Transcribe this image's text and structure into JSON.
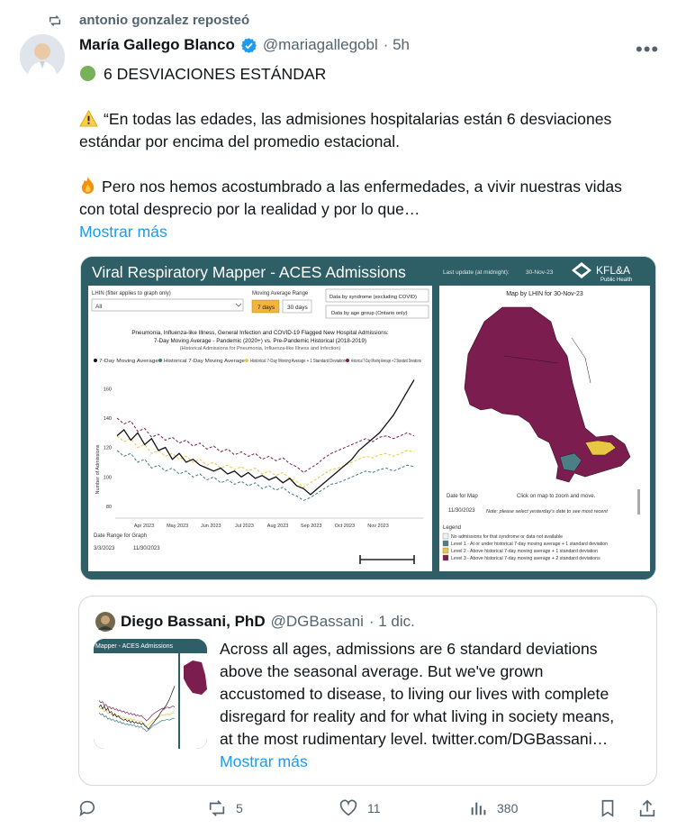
{
  "repost": {
    "text": "antonio gonzalez reposteó"
  },
  "tweet": {
    "author_name": "María Gallego Blanco",
    "handle": "@mariagallegobl",
    "time": "· 5h",
    "lines": [
      "6 DESVIACIONES ESTÁNDAR",
      "“En todas las edades, las admisiones hospitalarias están 6 desviaciones",
      "estándar por encima del promedio estacional.",
      "Pero nos hemos acostumbrado a las enfermedades, a vivir nuestras vidas",
      "con total desprecio por la realidad y por lo que…"
    ],
    "show_more": "Mostrar más"
  },
  "media": {
    "title": "Viral Respiratory Mapper - ACES Admissions",
    "last_update_label": "Last update (at midnight):",
    "last_update_value": "30-Nov-23",
    "brand": "KFL&A",
    "brand_sub": "Public Health",
    "lhin_label": "LHIN (filter applies to graph only)",
    "lhin_value": "All",
    "moving_avg_label": "Moving Average Range",
    "btn_7days": "7 days",
    "btn_30days": "30 days",
    "btn_syndrome": "Data by syndrome (excluding COVID)",
    "btn_age": "Data by age group (Ontario only)",
    "chart_title_1": "Pneumonia, Influenza-like Illness, General Infection and COVID-19 Flagged New Hospital Admissions:",
    "chart_title_2": "7-Day Moving Average - Pandemic (2020+) vs. Pre-Pandemic Historical (2018-2019)",
    "chart_subtitle": "(Historical Admissions for Pneumonia, Influenza-like Illness and Infection)",
    "date_range_label": "Date Range for Graph",
    "date_from": "3/3/2023",
    "date_to": "11/30/2023",
    "map_title": "Map by LHIN for 30-Nov-23",
    "date_for_map_label": "Date for Map",
    "map_hint": "Click on map to zoom and move.",
    "map_date": "11/30/2023",
    "map_note": "Note: please select yesterday's date to see most recent",
    "legend_title": "Legend",
    "legend": [
      {
        "label": "No admissions for that syndrome or data not available",
        "color": "#f2f2f2"
      },
      {
        "label": "Level 1 - At or under historical 7-day moving average + 1 standard deviation",
        "color": "#4a7f86"
      },
      {
        "label": "Level 2 - Above historical 7-day moving average + 1 standard deviation",
        "color": "#e8c842"
      },
      {
        "label": "Level 3 - Above historical 7-day moving average + 2 standard deviations",
        "color": "#7b1d4e"
      }
    ]
  },
  "chart_data": {
    "type": "line",
    "title": "Pneumonia, Influenza-like Illness, General Infection and COVID-19 Flagged New Hospital Admissions: 7-Day Moving Average - Pandemic (2020+) vs. Pre-Pandemic Historical (2018-2019)",
    "ylabel": "Number of Admissions",
    "xlabel": "",
    "x_ticks": [
      "Apr 2023",
      "May 2023",
      "Jun 2023",
      "Jul 2023",
      "Aug 2023",
      "Sep 2023",
      "Oct 2023",
      "Nov 2023"
    ],
    "y_ticks": [
      80,
      100,
      120,
      140,
      160
    ],
    "ylim": [
      72,
      170
    ],
    "series": [
      {
        "name": "7-Day Moving Average",
        "color": "#111111",
        "dash": "",
        "values": [
          128,
          132,
          125,
          130,
          122,
          126,
          118,
          120,
          112,
          116,
          110,
          112,
          108,
          106,
          104,
          106,
          102,
          104,
          100,
          103,
          99,
          101,
          98,
          100,
          96,
          99,
          94,
          92,
          88,
          92,
          96,
          100,
          104,
          108,
          112,
          118,
          122,
          126,
          130,
          136,
          142,
          150,
          158,
          166
        ]
      },
      {
        "name": "Historical 7-Day Moving Average",
        "color": "#3d7d86",
        "dash": "3,2",
        "values": [
          118,
          114,
          116,
          110,
          112,
          106,
          108,
          104,
          106,
          102,
          104,
          100,
          102,
          98,
          100,
          96,
          98,
          95,
          97,
          94,
          96,
          92,
          94,
          91,
          93,
          89,
          87,
          84,
          86,
          89,
          92,
          95,
          96,
          98,
          100,
          102,
          104,
          103,
          105,
          106,
          104,
          106,
          108,
          107
        ]
      },
      {
        "name": "Historical 7-Day Moving Average + 1 Standard Deviation",
        "color": "#e8c842",
        "dash": "3,2",
        "values": [
          128,
          124,
          126,
          120,
          122,
          116,
          118,
          114,
          116,
          112,
          114,
          110,
          112,
          108,
          110,
          106,
          108,
          105,
          107,
          104,
          106,
          102,
          104,
          101,
          103,
          99,
          97,
          93,
          96,
          99,
          102,
          105,
          106,
          108,
          110,
          112,
          114,
          113,
          115,
          116,
          114,
          116,
          118,
          117
        ]
      },
      {
        "name": "Historical 7-Day Moving Average + 2 Standard Deviations",
        "color": "#7b1d4e",
        "dash": "3,2",
        "values": [
          140,
          136,
          138,
          131,
          133,
          127,
          129,
          125,
          127,
          123,
          125,
          121,
          123,
          119,
          121,
          117,
          119,
          115,
          117,
          114,
          116,
          112,
          114,
          111,
          113,
          109,
          107,
          103,
          106,
          109,
          113,
          116,
          118,
          120,
          122,
          124,
          126,
          124,
          127,
          128,
          126,
          128,
          130,
          128
        ]
      }
    ],
    "grid": false,
    "legend_position": "top"
  },
  "quote": {
    "author_name": "Diego Bassani, PhD",
    "handle": "@DGBassani",
    "time": "· 1 dic.",
    "thumb_title": "Mapper - ACES Admissions",
    "lines": [
      "Across all ages, admissions are 6 standard deviations",
      "above the seasonal average. But we've grown",
      "accustomed to disease, to living our lives with complete",
      "disregard for reality and for what living in society means,",
      "at the most rudimentary level.  twitter.com/DGBassani…"
    ],
    "show_more": "Mostrar más"
  },
  "actions": {
    "reposts": "5",
    "likes": "11",
    "views": "380"
  },
  "colors": {
    "accent": "#1d9bf0",
    "verified": "#1d9bf0",
    "secondary_text": "#536471",
    "dashboard_teal": "#2f5f66"
  }
}
